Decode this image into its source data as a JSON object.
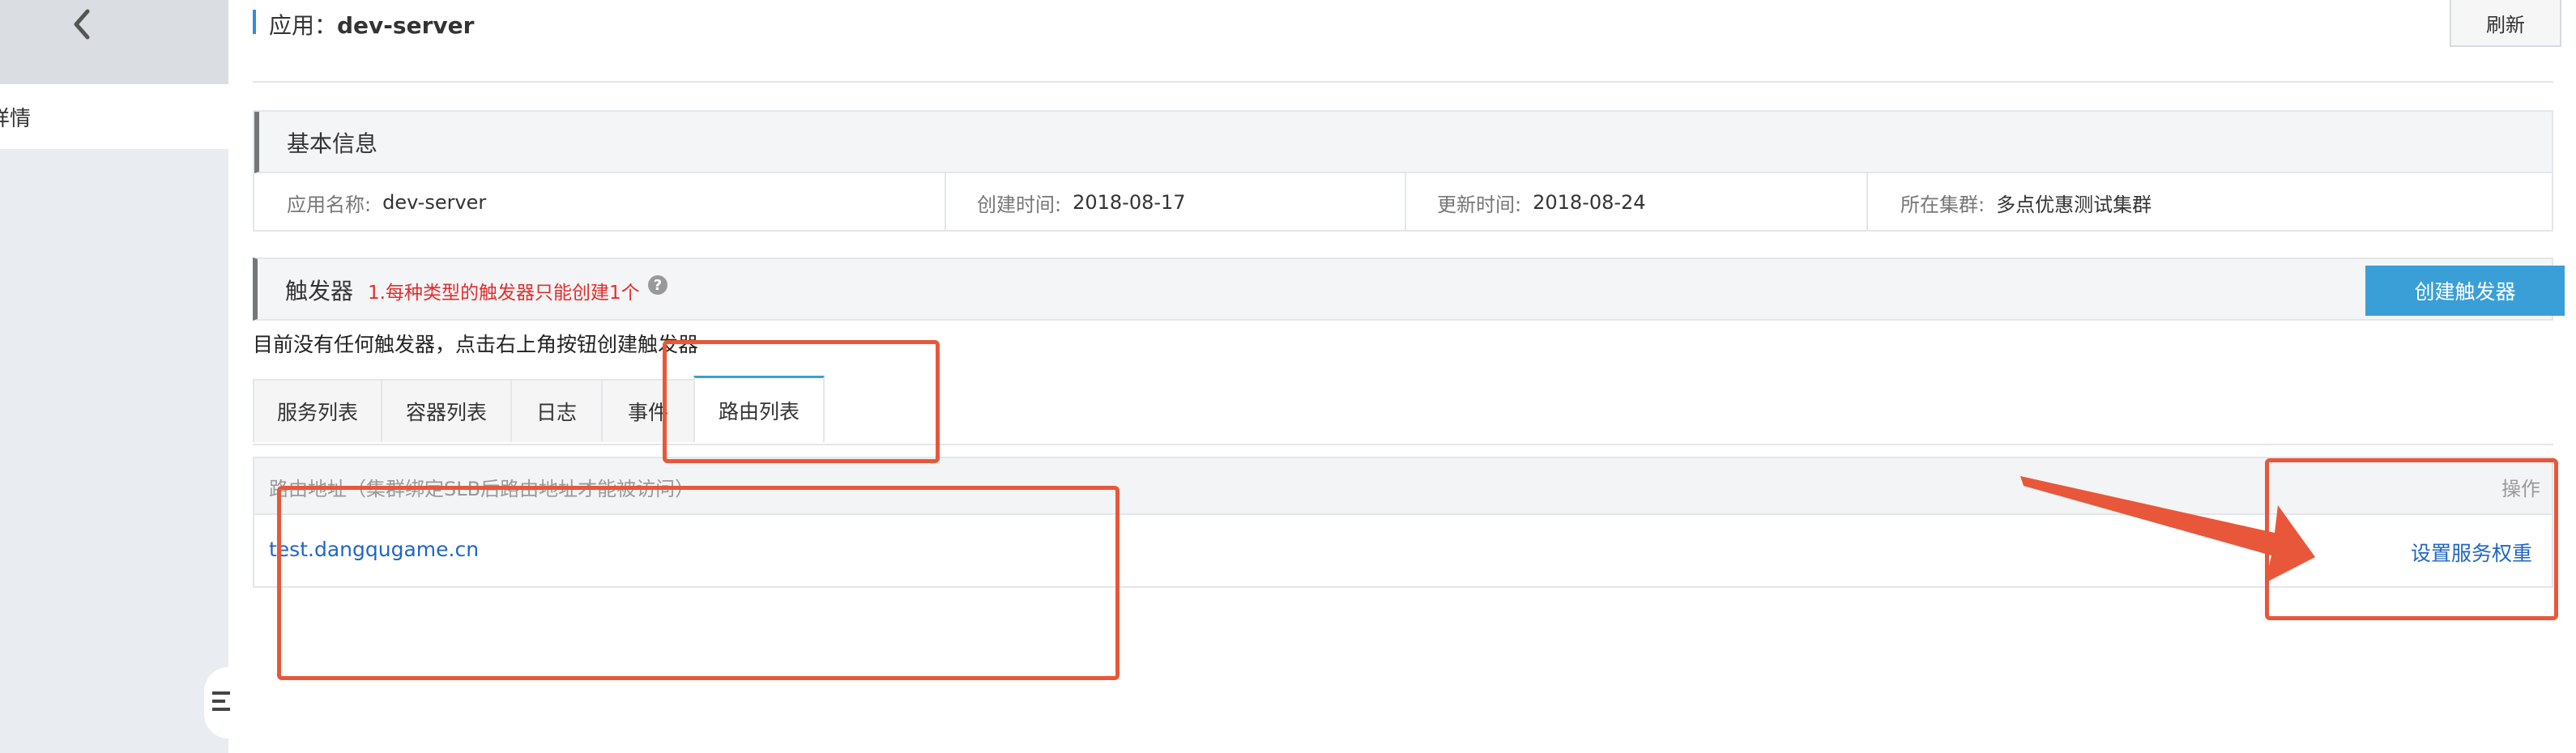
{
  "sidebar": {
    "active_item": "详情"
  },
  "header": {
    "label": "应用：",
    "app_name": "dev-server",
    "refresh_label": "刷新"
  },
  "basic_info": {
    "title": "基本信息",
    "fields": [
      {
        "label": "应用名称:",
        "value": "dev-server"
      },
      {
        "label": "创建时间:",
        "value": "2018-08-17"
      },
      {
        "label": "更新时间:",
        "value": "2018-08-24"
      },
      {
        "label": "所在集群:",
        "value": "多点优惠测试集群"
      }
    ]
  },
  "triggers": {
    "title": "触发器",
    "note": "1.每种类型的触发器只能创建1个",
    "help_icon": "?",
    "create_label": "创建触发器",
    "empty_text": "目前没有任何触发器，点击右上角按钮创建触发器"
  },
  "tabs": [
    {
      "label": "服务列表"
    },
    {
      "label": "容器列表"
    },
    {
      "label": "日志"
    },
    {
      "label": "事件"
    },
    {
      "label": "路由列表"
    }
  ],
  "route_table": {
    "columns": [
      "路由地址（集群绑定SLB后路由地址才能被访问）",
      "操作"
    ],
    "rows": [
      {
        "address": "test.dangqugame.cn",
        "action": "设置服务权重"
      }
    ]
  },
  "colors": {
    "primary": "#3a9fd6",
    "link": "#2166c4",
    "warning": "#e22e2e",
    "annotation": "#e8573a"
  }
}
